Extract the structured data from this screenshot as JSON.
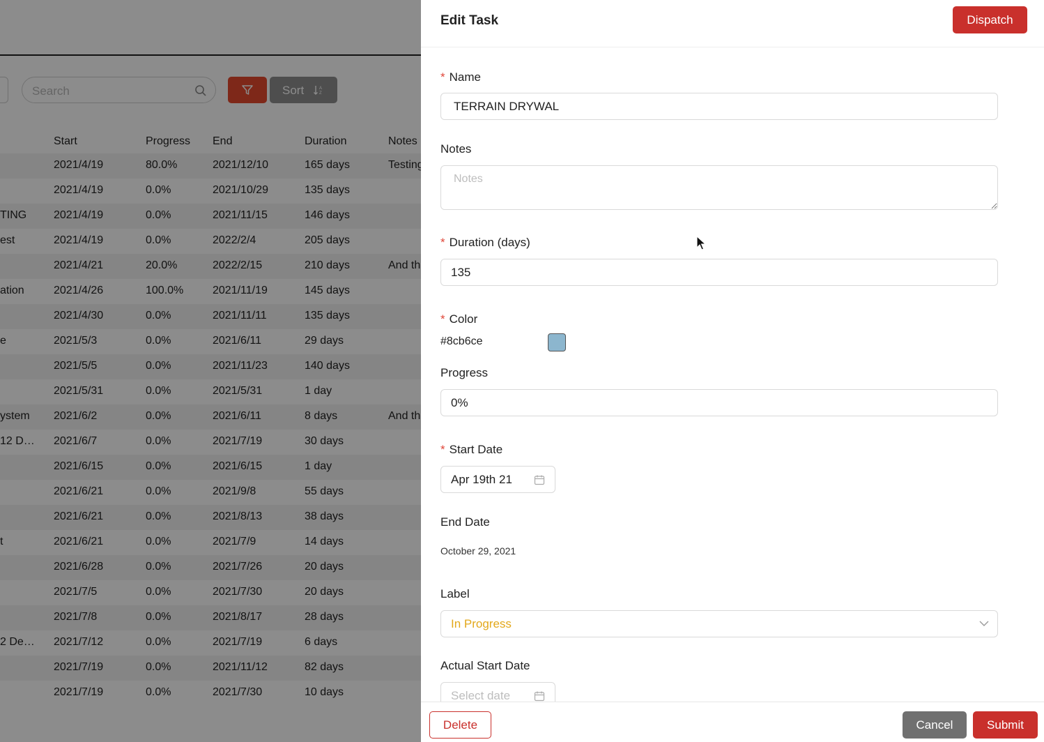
{
  "background": {
    "search_placeholder": "Search",
    "sort_label": "Sort",
    "table": {
      "columns": [
        "",
        "Start",
        "Progress",
        "End",
        "Duration",
        "Notes"
      ],
      "rows": [
        [
          "",
          "2021/4/19",
          "80.0%",
          "2021/12/10",
          "165 days",
          "Testing"
        ],
        [
          "",
          "2021/4/19",
          "0.0%",
          "2021/10/29",
          "135 days",
          ""
        ],
        [
          "TING",
          "2021/4/19",
          "0.0%",
          "2021/11/15",
          "146 days",
          ""
        ],
        [
          "est",
          "2021/4/19",
          "0.0%",
          "2022/2/4",
          "205 days",
          ""
        ],
        [
          "",
          "2021/4/21",
          "20.0%",
          "2022/2/15",
          "210 days",
          "And th"
        ],
        [
          "ation",
          "2021/4/26",
          "100.0%",
          "2021/11/19",
          "145 days",
          ""
        ],
        [
          "",
          "2021/4/30",
          "0.0%",
          "2021/11/11",
          "135 days",
          ""
        ],
        [
          "e",
          "2021/5/3",
          "0.0%",
          "2021/6/11",
          "29 days",
          ""
        ],
        [
          "",
          "2021/5/5",
          "0.0%",
          "2021/11/23",
          "140 days",
          ""
        ],
        [
          "",
          "2021/5/31",
          "0.0%",
          "2021/5/31",
          "1 day",
          ""
        ],
        [
          "ystem",
          "2021/6/2",
          "0.0%",
          "2021/6/11",
          "8 days",
          "And th"
        ],
        [
          "12 D…",
          "2021/6/7",
          "0.0%",
          "2021/7/19",
          "30 days",
          ""
        ],
        [
          "",
          "2021/6/15",
          "0.0%",
          "2021/6/15",
          "1 day",
          ""
        ],
        [
          "",
          "2021/6/21",
          "0.0%",
          "2021/9/8",
          "55 days",
          ""
        ],
        [
          "",
          "2021/6/21",
          "0.0%",
          "2021/8/13",
          "38 days",
          ""
        ],
        [
          "t",
          "2021/6/21",
          "0.0%",
          "2021/7/9",
          "14 days",
          ""
        ],
        [
          "",
          "2021/6/28",
          "0.0%",
          "2021/7/26",
          "20 days",
          ""
        ],
        [
          "",
          "2021/7/5",
          "0.0%",
          "2021/7/30",
          "20 days",
          ""
        ],
        [
          "",
          "2021/7/8",
          "0.0%",
          "2021/8/17",
          "28 days",
          ""
        ],
        [
          "2 De…",
          "2021/7/12",
          "0.0%",
          "2021/7/19",
          "6 days",
          ""
        ],
        [
          "",
          "2021/7/19",
          "0.0%",
          "2021/11/12",
          "82 days",
          ""
        ],
        [
          "",
          "2021/7/19",
          "0.0%",
          "2021/7/30",
          "10 days",
          ""
        ]
      ]
    }
  },
  "drawer": {
    "title": "Edit Task",
    "dispatch_label": "Dispatch",
    "name_label": "Name",
    "name_value": "TERRAIN DRYWAL",
    "notes_label": "Notes",
    "notes_placeholder": "Notes",
    "duration_label": "Duration (days)",
    "duration_value": "135",
    "color_label": "Color",
    "color_value": "#8cb6ce",
    "progress_label": "Progress",
    "progress_value": "0%",
    "start_date_label": "Start Date",
    "start_date_value": "Apr 19th 21",
    "end_date_label": "End Date",
    "end_date_value": "October 29, 2021",
    "label_label": "Label",
    "label_value": "In Progress",
    "actual_start_label": "Actual Start Date",
    "actual_start_placeholder": "Select date",
    "delete_label": "Delete",
    "cancel_label": "Cancel",
    "submit_label": "Submit"
  },
  "colors": {
    "brand_red": "#c9302c",
    "filter_red": "#e54a2e",
    "label_amber": "#e3a81b"
  },
  "icons": {
    "search": "search-icon",
    "filter": "filter-icon",
    "sort": "sort-icon",
    "calendar": "calendar-icon",
    "chevron": "chevron-down-icon",
    "cursor": "mouse-cursor-icon"
  }
}
